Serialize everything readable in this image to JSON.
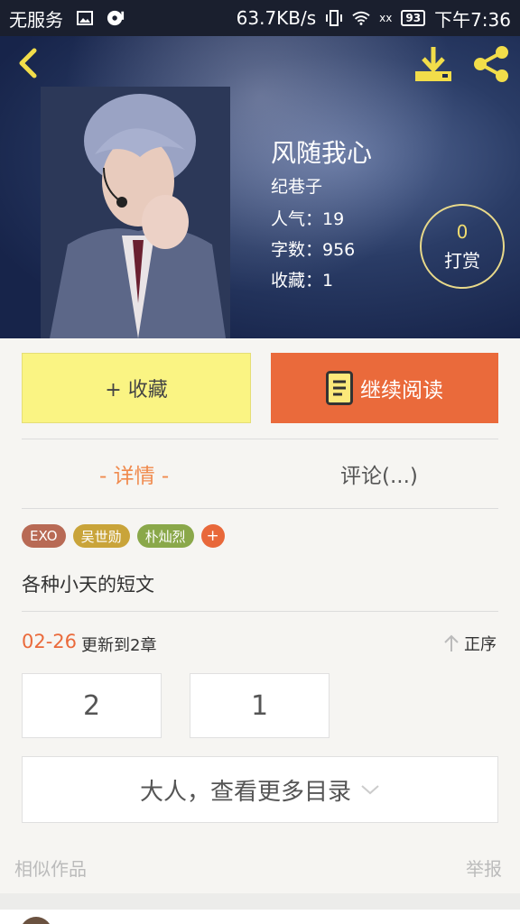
{
  "status_bar": {
    "carrier": "无服务",
    "network_speed": "63.7KB/s",
    "battery": "93",
    "time": "下午7:36",
    "signal_text": "xx"
  },
  "book": {
    "title": "风随我心",
    "author": "纪巷子",
    "popularity": "人气：19",
    "word_count": "字数：956",
    "favorites": "收藏：1"
  },
  "tip": {
    "count": "0",
    "label": "打赏"
  },
  "actions": {
    "collect": "+ 收藏",
    "continue_reading": "继续阅读"
  },
  "tabs": {
    "details": "- 详情 -",
    "comments": "评论(...)"
  },
  "tags": [
    {
      "label": "EXO",
      "color": "#b86a55"
    },
    {
      "label": "吴世勋",
      "color": "#c9a43a"
    },
    {
      "label": "朴灿烈",
      "color": "#8aa84a"
    }
  ],
  "tag_add": "+",
  "description": "各种小天的短文",
  "update": {
    "date": "02-26",
    "text": "更新到2章",
    "sort_label": "正序"
  },
  "chapters": [
    "2",
    "1"
  ],
  "more_directory": "大人，查看更多目录",
  "footer": {
    "similar": "相似作品",
    "report": "举报"
  },
  "colors": {
    "accent": "#ea6a3b",
    "collect_bg": "#faf483",
    "tab_active": "#f08a4d"
  }
}
